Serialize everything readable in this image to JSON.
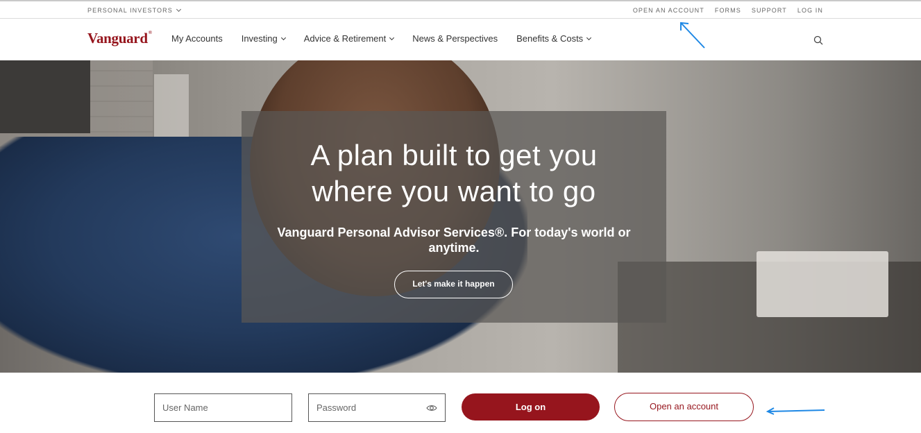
{
  "utility": {
    "segment_label": "PERSONAL INVESTORS",
    "links": [
      "OPEN AN ACCOUNT",
      "FORMS",
      "SUPPORT",
      "LOG IN"
    ]
  },
  "nav": {
    "logo": "Vanguard",
    "items": [
      {
        "label": "My Accounts",
        "has_menu": false
      },
      {
        "label": "Investing",
        "has_menu": true
      },
      {
        "label": "Advice & Retirement",
        "has_menu": true
      },
      {
        "label": "News & Perspectives",
        "has_menu": false
      },
      {
        "label": "Benefits & Costs",
        "has_menu": true
      }
    ],
    "search_icon": "search-icon"
  },
  "hero": {
    "headline_line1": "A plan built to get you",
    "headline_line2": "where you want to go",
    "subhead": "Vanguard Personal Advisor Services®. For today's world or anytime.",
    "cta_label": "Let's make it happen"
  },
  "login": {
    "username_placeholder": "User Name",
    "password_placeholder": "Password",
    "logon_label": "Log on",
    "open_account_label": "Open an account"
  },
  "colors": {
    "brand": "#96151d",
    "annotation_arrow": "#1e88e5"
  }
}
